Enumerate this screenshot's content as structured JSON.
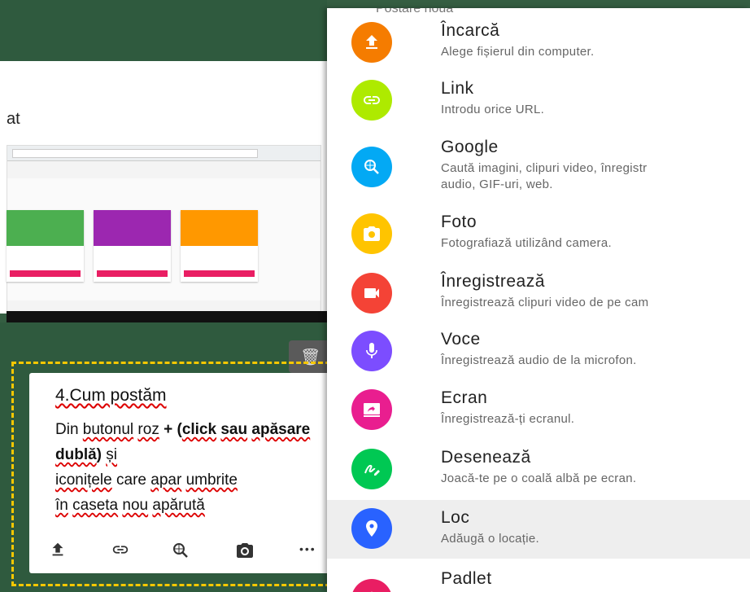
{
  "background": {
    "card_partial_text": "at"
  },
  "post_card": {
    "title": "4.Cum postăm",
    "body_parts": [
      "Din ",
      "butonul",
      " ",
      "roz",
      " + (",
      "click",
      " ",
      "sau",
      " ",
      "apăsare",
      " ",
      "dublă",
      ")  ",
      "și",
      " ",
      "iconițele",
      " care ",
      "apar",
      " ",
      "umbrite",
      " ",
      "în",
      " ",
      "caseta",
      " ",
      "nou",
      " ",
      "apărută"
    ],
    "more_label": "•••"
  },
  "menu": {
    "header": "Postare nouă",
    "items": [
      {
        "title": "Încarcă",
        "desc": "Alege fișierul din computer.",
        "color": "#f57c00",
        "icon": "upload-icon"
      },
      {
        "title": "Link",
        "desc": "Introdu orice URL.",
        "color": "#aeea00",
        "icon": "link-icon"
      },
      {
        "title": "Google",
        "desc": "Caută imagini, clipuri video, înregistr",
        "desc2": "audio, GIF-uri, web.",
        "color": "#03a9f4",
        "icon": "image-search-icon"
      },
      {
        "title": "Foto",
        "desc": "Fotografiază utilizând camera.",
        "color": "#ffc400",
        "icon": "camera-icon"
      },
      {
        "title": "Înregistrează",
        "desc": "Înregistrează clipuri video de pe cam",
        "color": "#f44336",
        "icon": "video-icon"
      },
      {
        "title": "Voce",
        "desc": "Înregistrează audio de la microfon.",
        "color": "#7c4dff",
        "icon": "microphone-icon"
      },
      {
        "title": "Ecran",
        "desc": "Înregistrează-ți ecranul.",
        "color": "#e91e8f",
        "icon": "screen-share-icon"
      },
      {
        "title": "Desenează",
        "desc": "Joacă-te pe o coală albă pe ecran.",
        "color": "#00c853",
        "icon": "draw-icon"
      },
      {
        "title": "Loc",
        "desc": "Adăugă o locație.",
        "color": "#2962ff",
        "icon": "location-pin-icon"
      },
      {
        "title": "Padlet",
        "desc": "",
        "color": "#e91e63",
        "icon": "padlet-icon"
      }
    ]
  }
}
